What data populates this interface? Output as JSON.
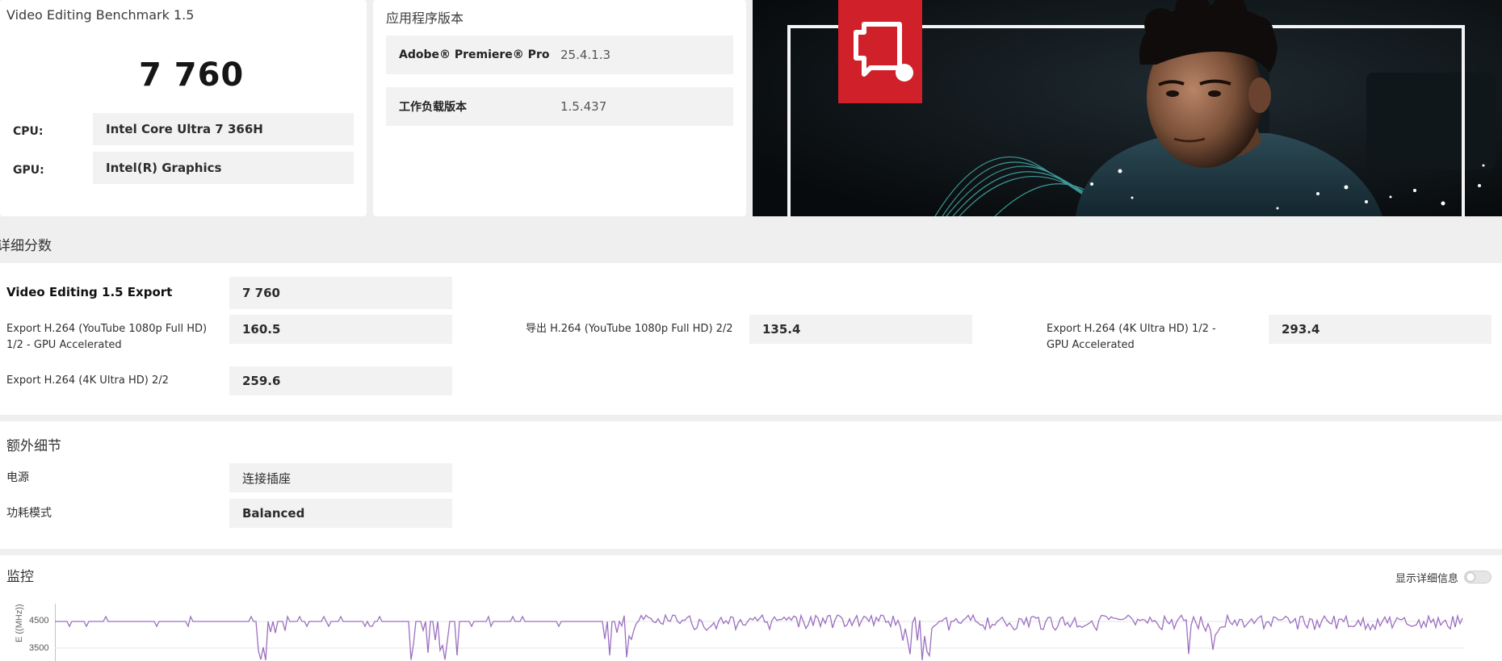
{
  "summary_card": {
    "title": "Video Editing Benchmark 1.5",
    "score": "7 760",
    "cpu_label": "CPU:",
    "cpu_value": "Intel Core Ultra 7 366H",
    "gpu_label": "GPU:",
    "gpu_value": "Intel(R) Graphics"
  },
  "app_card": {
    "title": "应用程序版本",
    "rows": [
      {
        "label": "Adobe® Premiere® Pro",
        "value": "25.4.1.3"
      },
      {
        "label": "工作负载版本",
        "value": "1.5.437"
      }
    ]
  },
  "hero": {
    "icon": "presentation-screen-icon",
    "accent_color": "#d0202a"
  },
  "detailed_scores": {
    "heading": "详细分数",
    "overall": {
      "label": "Video Editing 1.5 Export",
      "value": "7 760"
    },
    "tests": [
      {
        "label": "Export H.264 (YouTube 1080p Full HD) 1/2 - GPU Accelerated",
        "value": "160.5"
      },
      {
        "label": "导出 H.264 (YouTube 1080p Full HD) 2/2",
        "value": "135.4"
      },
      {
        "label": "Export H.264 (4K Ultra HD) 1/2 - GPU Accelerated",
        "value": "293.4"
      },
      {
        "label": "Export H.264 (4K Ultra HD) 2/2",
        "value": "259.6"
      }
    ]
  },
  "extra_details": {
    "heading": "额外细节",
    "rows": [
      {
        "label": "电源",
        "value": "连接插座"
      },
      {
        "label": "功耗模式",
        "value": "Balanced"
      }
    ]
  },
  "monitoring": {
    "heading": "监控",
    "toggle_label": "显示详细信息",
    "toggle_on": false,
    "line_color": "#9b6fc0",
    "y_ticks": [
      "4500",
      "3500"
    ],
    "y_axis_label": "E ((MHz))"
  }
}
